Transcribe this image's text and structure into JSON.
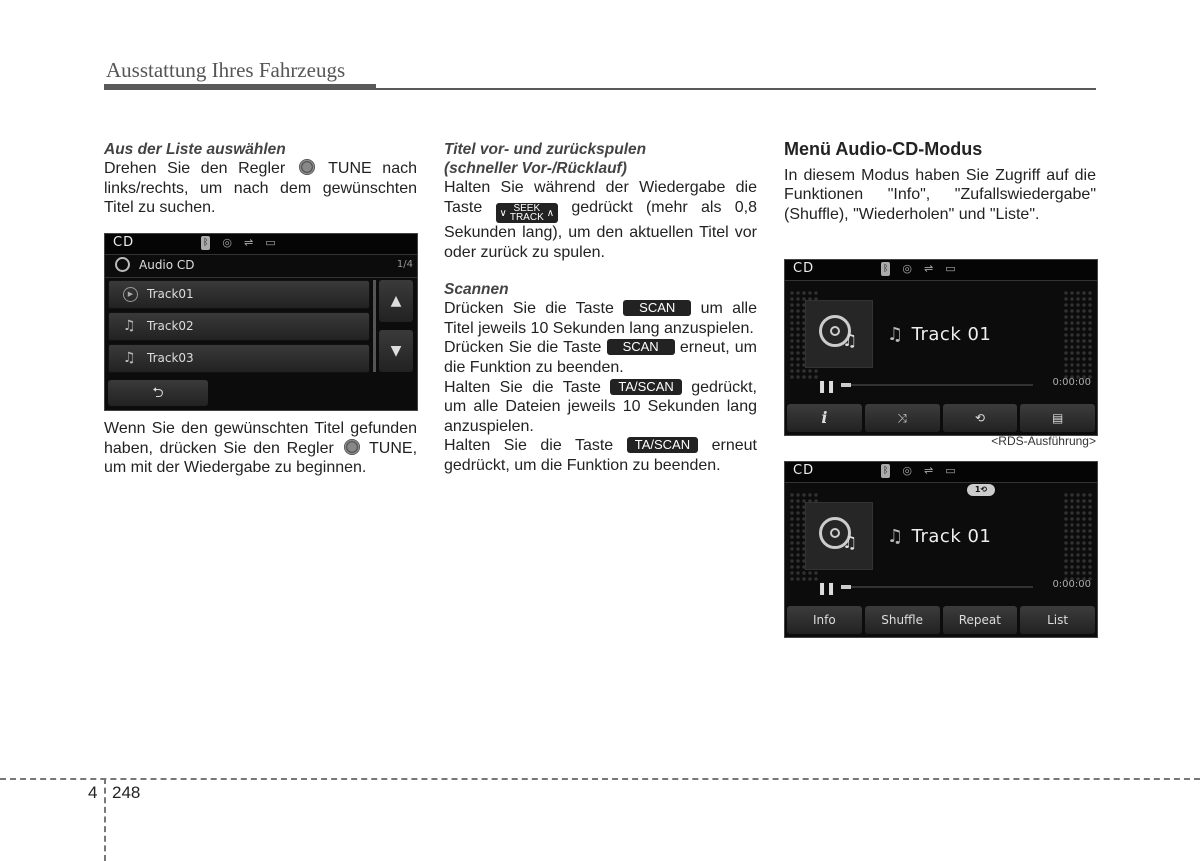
{
  "header": {
    "title": "Ausstattung Ihres Fahrzeugs"
  },
  "col1": {
    "subtitle": "Aus der Liste auswählen",
    "p1_a": "Drehen Sie den Regler",
    "p1_b": "TUNE nach links/rechts, um nach dem gewünschten Titel zu suchen.",
    "p2_a": "Wenn Sie den gewünschten Titel gefunden haben, drücken Sie den Regler",
    "p2_b": "TUNE, um mit der Wiedergabe zu beginnen."
  },
  "list_screen": {
    "mode": "CD",
    "icons": [
      "bluetooth-icon",
      "disc-icon",
      "usb-icon",
      "aux-icon"
    ],
    "list_title": "Audio CD",
    "page": "1/4",
    "tracks": [
      {
        "label": "Track01",
        "icon": "play-icon"
      },
      {
        "label": "Track02",
        "icon": "music-note-icon"
      },
      {
        "label": "Track03",
        "icon": "music-note-icon"
      }
    ],
    "up": "▲",
    "down": "▼",
    "back": "⮌"
  },
  "col2": {
    "sub1_l1": "Titel vor- und zurückspulen",
    "sub1_l2": "(schneller Vor-/Rücklauf)",
    "p1_a": "Halten Sie während der Wiedergabe die Taste",
    "seek_top": "SEEK",
    "seek_bottom": "TRACK",
    "p1_b": "gedrückt (mehr als 0,8 Sekunden lang), um den aktuellen Titel vor oder zurück zu spulen.",
    "sub2": "Scannen",
    "p2_a": "Drücken Sie die Taste",
    "scan_key": "SCAN",
    "p2_b": "um alle Titel jeweils 10 Sekunden lang anzuspielen.",
    "p3_a": "Drücken Sie die Taste",
    "p3_b": "erneut, um die Funktion zu beenden.",
    "p4_a": "Halten Sie die Taste",
    "tascan_key": "TA/SCAN",
    "p4_b": "gedrückt, um alle Dateien jeweils 10 Sekunden lang anzuspielen.",
    "p5_a": "Halten Sie die Taste",
    "p5_b": "erneut gedrückt, um die Funktion zu beenden."
  },
  "col3": {
    "heading": "Menü Audio-CD-Modus",
    "p1": "In diesem Modus haben Sie Zugriff auf die Funktionen \"Info\", \"Zufallswiedergabe\" (Shuffle), \"Wiederholen\" und \"Liste\"."
  },
  "player1": {
    "mode": "CD",
    "track": "Track 01",
    "time": "0:00:00",
    "progress": 0.05,
    "buttons": [
      "i",
      "⤨",
      "⟲",
      "▤"
    ],
    "caption": "<RDS-Ausführung>"
  },
  "player2": {
    "mode": "CD",
    "repeat_badge": "1⟲",
    "track": "Track 01",
    "time": "0:00:00",
    "progress": 0.05,
    "buttons": [
      "Info",
      "Shuffle",
      "Repeat",
      "List"
    ]
  },
  "footer": {
    "chapter": "4",
    "page": "248"
  }
}
